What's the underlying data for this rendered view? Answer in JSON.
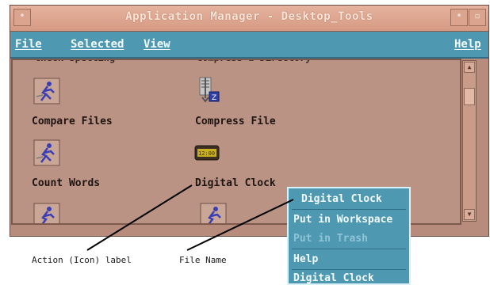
{
  "window": {
    "title": "Application Manager - Desktop_Tools",
    "minimize_symbol": "•",
    "maximize_symbol": "▫"
  },
  "menubar": {
    "file": "File",
    "selected": "Selected",
    "view": "View",
    "help": "Help"
  },
  "content": {
    "partial_top_left": "Check Spelling",
    "partial_top_right": "Compress a Directory",
    "icons": [
      {
        "label": "Compare Files",
        "icon": "action-runner-icon"
      },
      {
        "label": "Compress File",
        "icon": "compress-file-icon"
      },
      {
        "label": "Count Words",
        "icon": "action-runner-icon"
      },
      {
        "label": "Digital Clock",
        "icon": "digital-clock-icon"
      },
      {
        "label": "",
        "icon": "action-runner-icon"
      },
      {
        "label": "",
        "icon": "action-runner-icon"
      }
    ]
  },
  "popup_menu": {
    "title": "Digital Clock",
    "items": [
      {
        "label": "Put in Workspace",
        "enabled": true
      },
      {
        "label": "Put in Trash",
        "enabled": false
      },
      {
        "label": "Help",
        "enabled": true
      },
      {
        "label": "Digital Clock",
        "enabled": true
      }
    ]
  },
  "annotations": {
    "action_label": "Action (Icon) label",
    "file_name": "File Name"
  },
  "colors": {
    "titlebar": "#d69a83",
    "menubar": "#4f98b2",
    "content_bg": "#bb9384",
    "popup_bg": "#4f98b2"
  }
}
